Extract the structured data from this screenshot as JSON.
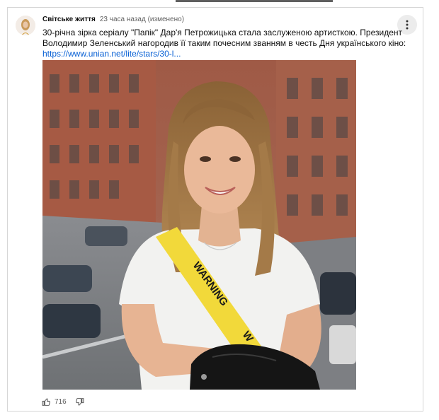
{
  "post": {
    "author": "Світське життя",
    "timestamp": "23 часа назад (изменено)",
    "text_line1": "30-річна зірка серіалу \"Папік\" Дар'я Петрожицька стала заслуженою артисткою. Президент",
    "text_line2": "Володимир Зеленський нагородив її таким почесним званням в честь Дня українського кіно:",
    "link": "https://www.unian.net/lite/stars/30-l..."
  },
  "photo": {
    "sash_text": "WARNING",
    "sash_text_partial": "W"
  },
  "actions": {
    "like_count": "716"
  },
  "icons": {
    "more": "more-vert-icon",
    "like": "thumbs-up-icon",
    "dislike": "thumbs-down-icon"
  },
  "colors": {
    "link": "#065fd4",
    "sash": "#f2d93a",
    "brick": "#b7614a"
  }
}
